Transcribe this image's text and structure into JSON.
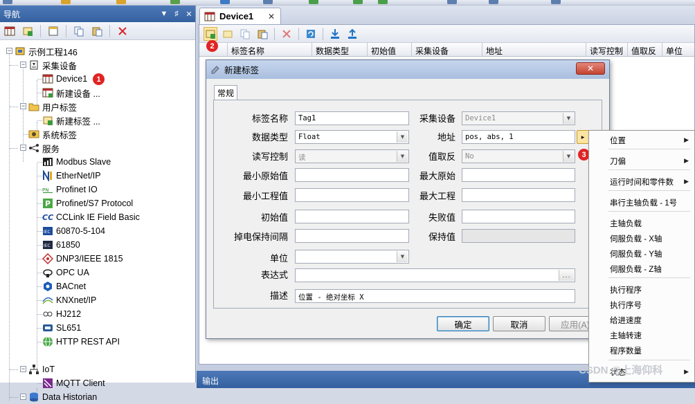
{
  "nav": {
    "title": "导航",
    "pin_glyph": "▼",
    "dock_glyph": "♯",
    "close_glyph": "✕",
    "tree": {
      "project": "示例工程146",
      "collect": "采集设备",
      "device1": "Device1",
      "new_device": "新建设备 ...",
      "user_tags": "用户标签",
      "new_tag": "新建标签 ...",
      "system_tags": "系统标签",
      "services": "服务",
      "svc": [
        "Modbus Slave",
        "EtherNet/IP",
        "Profinet IO",
        "Profinet/S7 Protocol",
        "CCLink IE Field Basic",
        "60870-5-104",
        "61850",
        "DNP3/IEEE 1815",
        "OPC UA",
        "BACnet",
        "KNXnet/IP",
        "HJ212",
        "SL651",
        "HTTP REST API"
      ],
      "iot": "IoT",
      "mqtt": "MQTT Client",
      "historian": "Data Historian"
    },
    "expand_minus": "−",
    "badge1": "1"
  },
  "doc": {
    "tab_label": "Device1",
    "tab_close": "✕",
    "badge2": "2",
    "columns": [
      "标签名称",
      "数据类型",
      "初始值",
      "采集设备",
      "地址",
      "读写控制",
      "值取反",
      "单位"
    ],
    "output_label": "输出"
  },
  "dialog": {
    "title": "新建标签",
    "close": "✕",
    "tab": "常规",
    "labels": {
      "tag_name": "标签名称",
      "data_type": "数据类型",
      "rw": "读写控制",
      "min_raw": "最小原始值",
      "min_eng": "最小工程值",
      "init": "初始值",
      "retain": "掉电保持间隔",
      "unit": "单位",
      "expr": "表达式",
      "desc": "描述",
      "device": "采集设备",
      "address": "地址",
      "invert": "值取反",
      "max_raw": "最大原始",
      "max_eng": "最大工程",
      "fail": "失败值",
      "hold": "保持值"
    },
    "values": {
      "tag_name": "Tag1",
      "data_type": "Float",
      "rw": "读",
      "device": "Device1",
      "address": "pos, abs, 1",
      "invert": "No",
      "desc": "位置 - 绝对坐标 X"
    },
    "expr_btn": "...",
    "addr_btn": "▸",
    "badge3": "3",
    "ok": "确定",
    "cancel": "取消",
    "apply": "应用(A)"
  },
  "menu": {
    "items": [
      "位置",
      "刀偏",
      "运行时间和零件数",
      "串行主轴负载 - 1号",
      "主轴负载",
      "伺服负载 - X轴",
      "伺服负载 - Y轴",
      "伺服负载 - Z轴",
      "执行程序",
      "执行序号",
      "给进速度",
      "主轴转速",
      "程序数量",
      "状态"
    ],
    "arrow": "▶"
  },
  "watermark": "CSDN @上海仰科",
  "colors": {
    "accent": "#3f6aa9",
    "badge": "#e02424"
  }
}
